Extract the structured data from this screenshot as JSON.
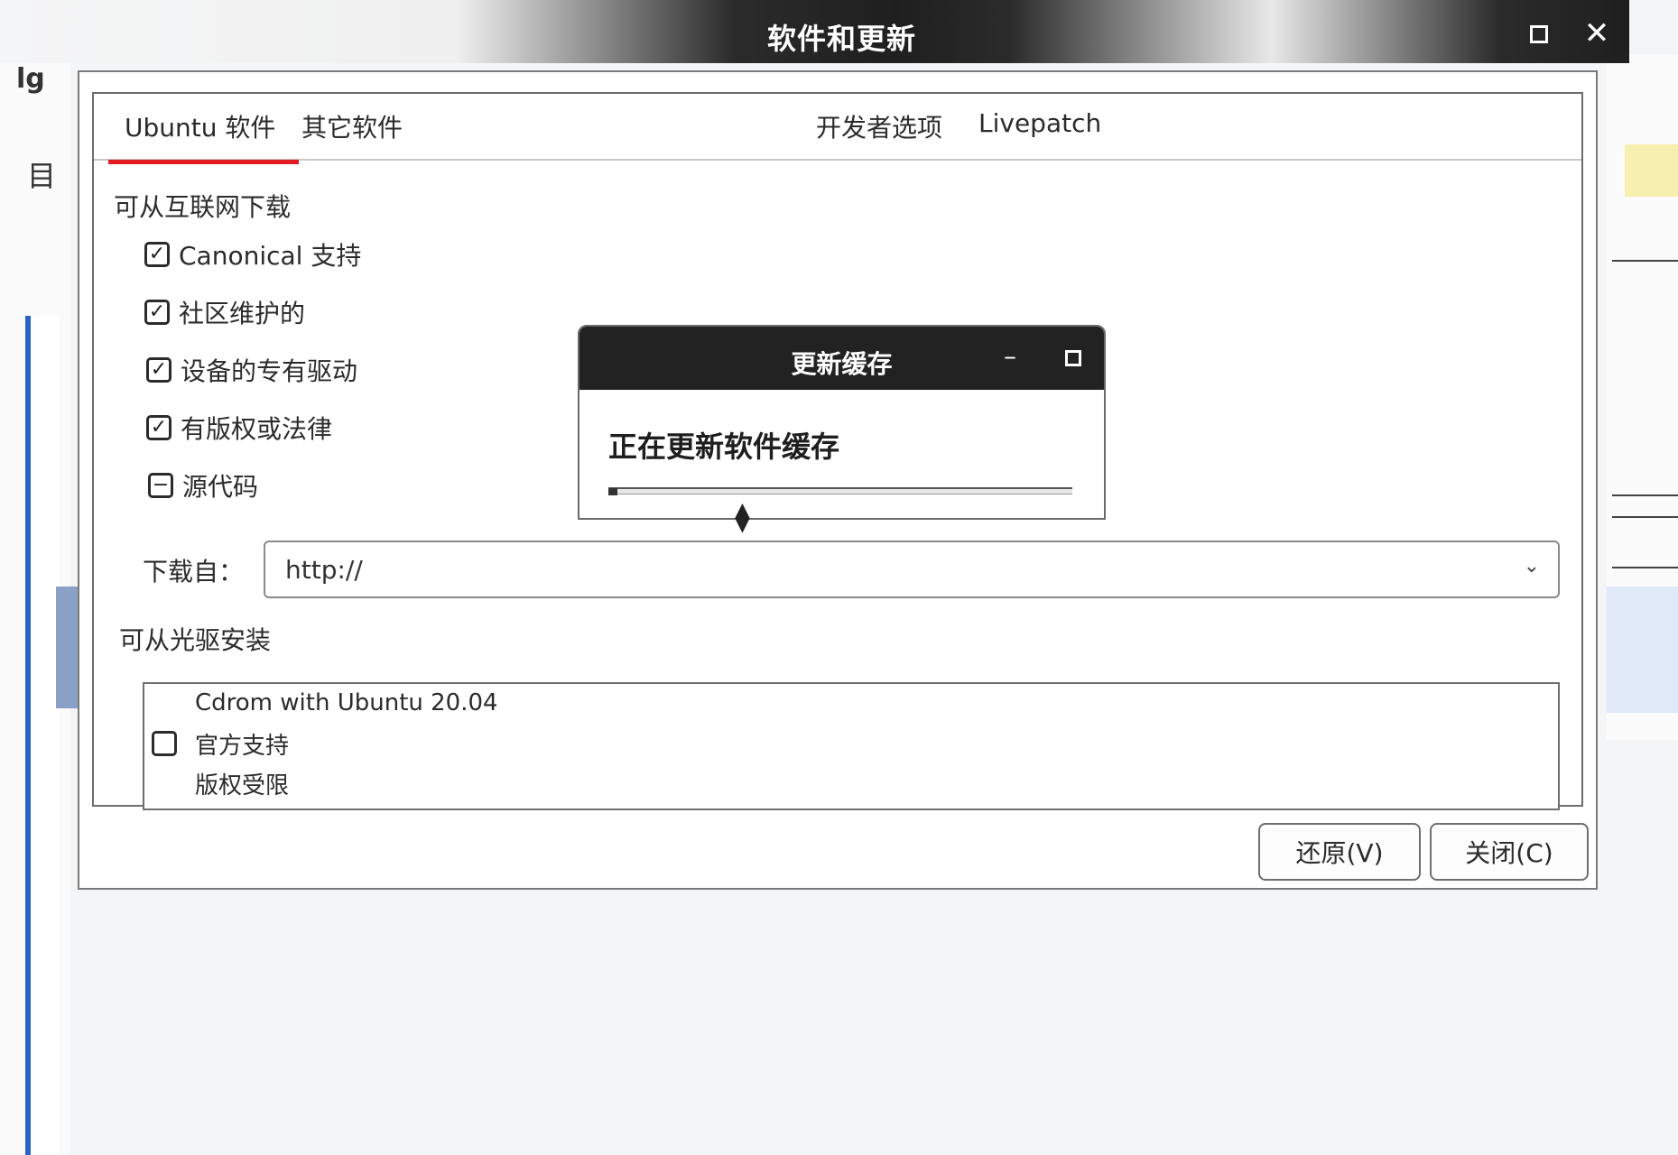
{
  "window": {
    "title": "软件和更新"
  },
  "background": {
    "left_fragment": "lg",
    "left_icon": "目"
  },
  "tabs": [
    {
      "label": "Ubuntu 软件"
    },
    {
      "label": "其它软件"
    },
    {
      "label": "开发者选项"
    },
    {
      "label": "Livepatch"
    }
  ],
  "internet_section": {
    "label": "可从互联网下载",
    "items": [
      {
        "label": "Canonical 支持",
        "checked": true
      },
      {
        "label": "社区维护的",
        "checked": true
      },
      {
        "label": "设备的专有驱动",
        "checked": true
      },
      {
        "label": "有版权或法律",
        "checked": true
      },
      {
        "label": "源代码",
        "checked": "mixed"
      }
    ]
  },
  "download_from": {
    "label": "下载自：",
    "value": "http://"
  },
  "cdrom_section": {
    "label": "可从光驱安装",
    "item": {
      "name": "Cdrom with Ubuntu 20.04",
      "line2": "官方支持",
      "line3": "版权受限",
      "checked": false
    }
  },
  "buttons": {
    "revert": "还原(V)",
    "close": "关闭(C)"
  },
  "dialog": {
    "title": "更新缓存",
    "message": "正在更新软件缓存",
    "progress": 0.02
  },
  "colors": {
    "tab_indicator": "#e01b24",
    "titlebar": "#222222"
  },
  "icons": {
    "check": "✓",
    "mixed": "−",
    "dropdown": "⌄",
    "close": "✕"
  }
}
